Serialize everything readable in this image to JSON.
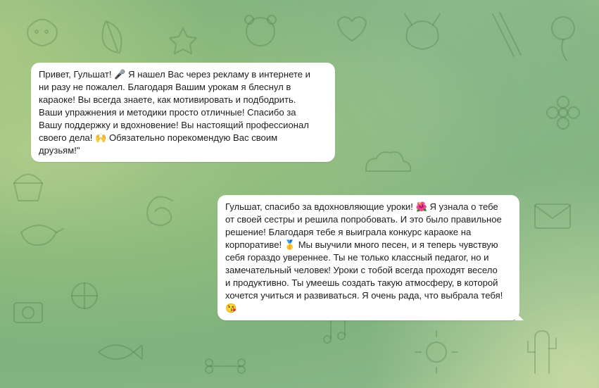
{
  "chat": {
    "messages": [
      {
        "direction": "incoming",
        "text": "Привет, Гульшат! 🎤 Я нашел Вас через рекламу в интернете и\nни разу не пожалел. Благодаря Вашим урокам я блеснул в\nкараоке! Вы всегда знаете, как мотивировать и подбодрить.\nВаши упражнения и методики просто отличные! Спасибо за\nВашу поддержку и вдохновение! Вы настоящий профессионал\nсвоего дела! 🙌 Обязательно порекомендую Вас своим\nдрузьям!\""
      },
      {
        "direction": "outgoing",
        "text": "Гульшат, спасибо за вдохновляющие уроки! 🌺 Я узнала о тебе\nот своей сестры и решила попробовать. И это было правильное\nрешение! Благодаря тебе я выиграла конкурс караоке на\nкорпоративе! 🥇 Мы выучили много песен, и я теперь чувствую\nсебя гораздо увереннее. Ты не только классный педагог, но и\nзамечательный человек! Уроки с тобой всегда проходят весело\nи продуктивно. Ты умеешь создать такую атмосферу, в которой\nхочется учиться и развиваться. Я очень рада, что выбрала тебя!\n😘"
      }
    ]
  },
  "colors": {
    "bubble_bg": "#ffffff",
    "text": "#1d1d1d",
    "wallpaper_mid": "#7fb27e"
  }
}
